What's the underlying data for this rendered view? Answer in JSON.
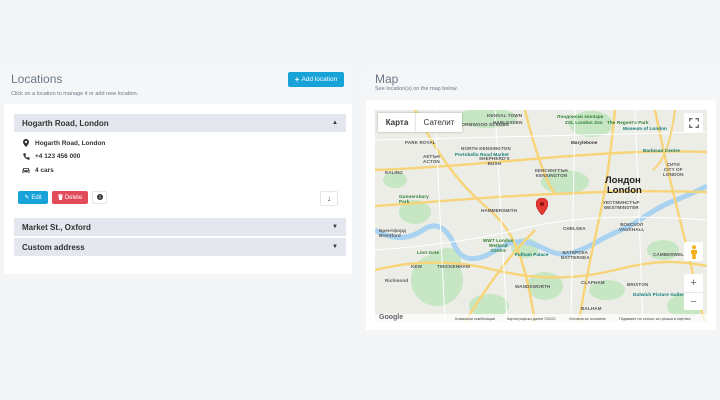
{
  "locations": {
    "title": "Locations",
    "subtitle": "Click on a location to manage it or add new location.",
    "add_button": "Add location",
    "items": [
      {
        "name": "Hogarth Road, London",
        "expanded": true,
        "address": "Hogarth Road, London",
        "phone": "+4 123 456 000",
        "cars": "4 cars"
      },
      {
        "name": "Market St., Oxford",
        "expanded": false
      },
      {
        "name": "Custom address",
        "expanded": false
      }
    ],
    "edit_label": "Edit",
    "delete_label": "Delete"
  },
  "map": {
    "title": "Map",
    "subtitle": "See location(s) on the map below.",
    "type_map": "Карта",
    "type_satellite": "Сателит",
    "labels": {
      "kensal": "KENSAL TOWN",
      "wormwood": "WORMWOOD SCRUBS",
      "harlesden": "HARLESDEN",
      "london_zoo": "Лондонски зоопарк",
      "zsl": "ZSL London Zoo",
      "regents_park": "The Regent's Park",
      "museum": "Museum of London",
      "park_royal": "PARK ROYAL",
      "north_ken": "NORTH KENSINGTON",
      "marylebone": "Marylebone",
      "barbican": "Barbican Centre",
      "portobello": "Portobello Road Market",
      "ealing": "EALING",
      "acton": "АКТЪН\nACTON",
      "shepherds": "SHEPHERD'S\nBUSH",
      "kensington": "КЕНСИНГТЪН\nKENSINGTON",
      "london_bg": "Лондон",
      "london_en": "London",
      "westminster": "УЕСТМИНСТЪР\nWESTMINSTER",
      "city": "СИТИ\nCITY OF\nLONDON",
      "gunnersbury": "Gunnersbury\nPark",
      "hammersmith": "HAMMERSMITH",
      "brentford": "Брентфорд\nBrentford",
      "wwt": "WWT London\nWetland\nCentre",
      "fulham": "Fulham Palace",
      "chelsea": "CHELSEA",
      "vauxhall": "ВОКСХОЛ\nVAUXHALL",
      "battersea": "БАТЕРСЕА\nBATTERSEA",
      "lion_gate": "Lion Gate",
      "kew": "KEW",
      "twickenham": "TWICKENHAM",
      "camberwell": "CAMBERWELL",
      "wandsworth": "WANDSWORTH",
      "clapham": "CLAPHAM",
      "brixton": "BRIXTON",
      "richmond": "Richmond",
      "balham": "BALHAM",
      "dulwich": "Dulwich Picture Gallery"
    },
    "footer": {
      "shortcuts": "Клавишни комбинации",
      "data": "Картографски данни ©2022",
      "terms": "Условия за ползване",
      "report": "Подаване на сигнал за грешка в картата",
      "google": "Google"
    },
    "colors": {
      "water": "#a9d3f0",
      "park": "#c6e6c4",
      "road_major": "#f7d477",
      "pin": "#e53935"
    }
  }
}
